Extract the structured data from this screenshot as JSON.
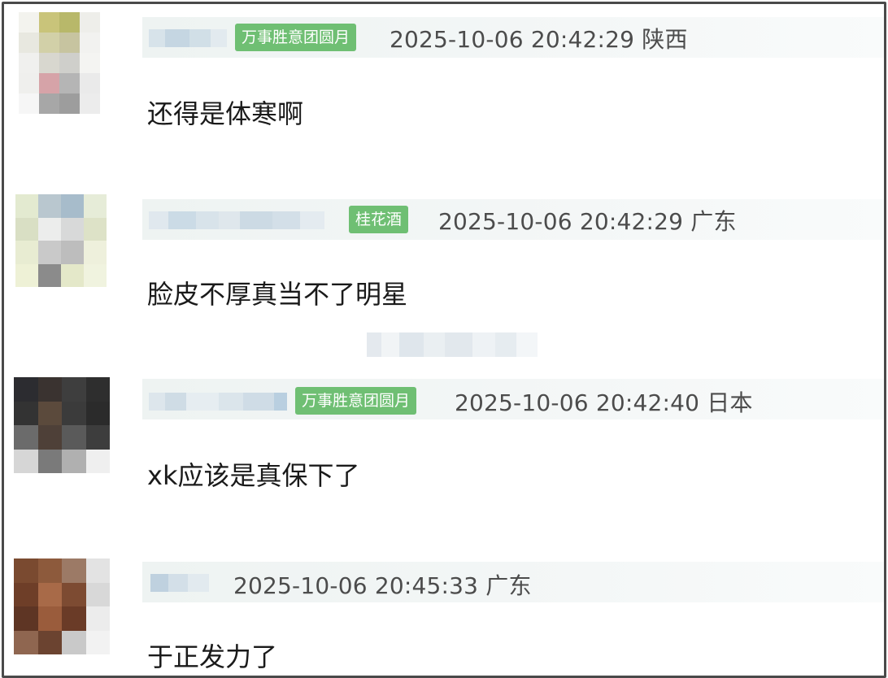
{
  "comments": [
    {
      "badge": "万事胜意团圆月",
      "timestamp": "2025-10-06 20:42:29",
      "location": "陕西",
      "text": "还得是体寒啊"
    },
    {
      "badge": "桂花酒",
      "timestamp": "2025-10-06 20:42:29",
      "location": "广东",
      "text": "脸皮不厚真当不了明星"
    },
    {
      "badge": "万事胜意团圆月",
      "timestamp": "2025-10-06 20:42:40",
      "location": "日本",
      "text": "xk应该是真保下了"
    },
    {
      "timestamp": "2025-10-06 20:45:33",
      "location": "广东",
      "text": "于正发力了"
    }
  ],
  "colors": {
    "badge_bg": "#6fbf73",
    "meta_text": "#4c4c4c",
    "comment_text": "#1a1a1a",
    "frame_border": "#4a4a4a"
  }
}
